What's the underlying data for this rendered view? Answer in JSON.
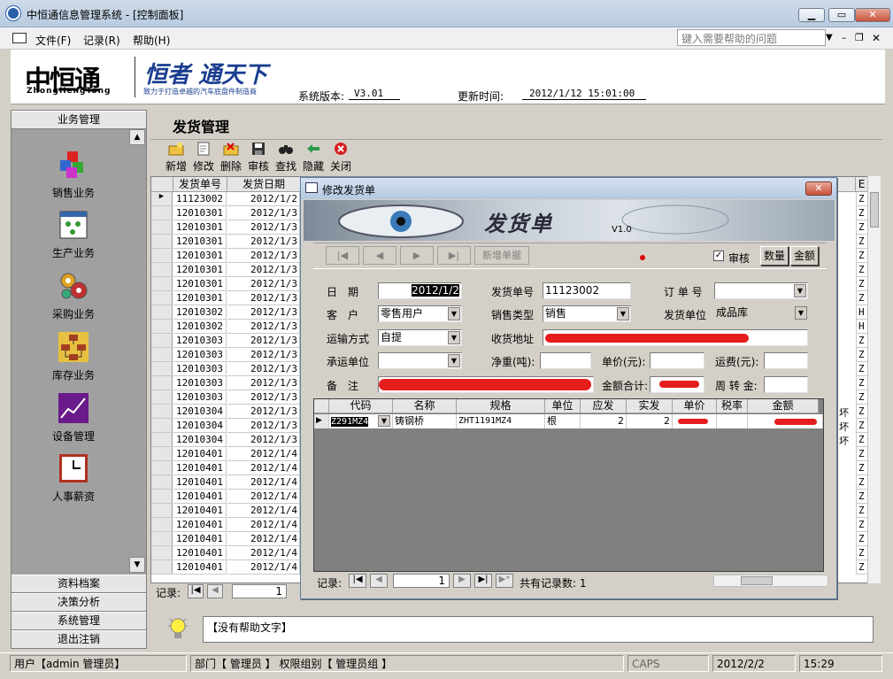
{
  "window": {
    "title": "中恒通信息管理系统 - [控制面板]"
  },
  "menu": {
    "items": [
      "文件(F)",
      "记录(R)",
      "帮助(H)"
    ],
    "help_placeholder": "键入需要帮助的问题"
  },
  "banner": {
    "logo_text": "中恒通",
    "logo_sub": "ZhongHengTong",
    "slogan": "恒者 通天下",
    "slogan_sub": "致力于打造卓越的汽车底盘件制造商",
    "version_label": "系统版本:",
    "version": "V3.01",
    "update_label": "更新时间:",
    "update_time": "2012/1/12 15:01:00"
  },
  "sidebar": {
    "top_header": "业务管理",
    "items": [
      "销售业务",
      "生产业务",
      "采购业务",
      "库存业务",
      "设备管理",
      "人事薪资"
    ],
    "bottom_headers": [
      "资料档案",
      "决策分析",
      "系统管理",
      "退出注销"
    ]
  },
  "main": {
    "title": "发货管理",
    "toolbar": [
      "新增",
      "修改",
      "删除",
      "审核",
      "查找",
      "隐藏",
      "关闭"
    ],
    "grid": {
      "headers": [
        "发货单号",
        "发货日期"
      ],
      "rows": [
        {
          "no": "11123002",
          "date": "2012/1/2",
          "tail": "Z"
        },
        {
          "no": "12010301",
          "date": "2012/1/3",
          "tail": "Z"
        },
        {
          "no": "12010301",
          "date": "2012/1/3",
          "tail": "Z"
        },
        {
          "no": "12010301",
          "date": "2012/1/3",
          "tail": "Z"
        },
        {
          "no": "12010301",
          "date": "2012/1/3",
          "tail": "Z"
        },
        {
          "no": "12010301",
          "date": "2012/1/3",
          "tail": "Z"
        },
        {
          "no": "12010301",
          "date": "2012/1/3",
          "tail": "Z"
        },
        {
          "no": "12010301",
          "date": "2012/1/3",
          "tail": "Z"
        },
        {
          "no": "12010302",
          "date": "2012/1/3",
          "tail": "H"
        },
        {
          "no": "12010302",
          "date": "2012/1/3",
          "tail": "H"
        },
        {
          "no": "12010303",
          "date": "2012/1/3",
          "tail": "Z"
        },
        {
          "no": "12010303",
          "date": "2012/1/3",
          "tail": "Z"
        },
        {
          "no": "12010303",
          "date": "2012/1/3",
          "tail": "Z"
        },
        {
          "no": "12010303",
          "date": "2012/1/3",
          "tail": "Z"
        },
        {
          "no": "12010303",
          "date": "2012/1/3",
          "tail": "Z"
        },
        {
          "no": "12010304",
          "date": "2012/1/3",
          "tail": "Z"
        },
        {
          "no": "12010304",
          "date": "2012/1/3",
          "tail": "Z"
        },
        {
          "no": "12010304",
          "date": "2012/1/3",
          "tail": "Z"
        },
        {
          "no": "12010401",
          "date": "2012/1/4",
          "tail": "Z"
        },
        {
          "no": "12010401",
          "date": "2012/1/4",
          "tail": "Z"
        },
        {
          "no": "12010401",
          "date": "2012/1/4",
          "tail": "Z"
        },
        {
          "no": "12010401",
          "date": "2012/1/4",
          "tail": "Z"
        },
        {
          "no": "12010401",
          "date": "2012/1/4",
          "tail": "Z"
        },
        {
          "no": "12010401",
          "date": "2012/1/4",
          "tail": "Z"
        },
        {
          "no": "12010401",
          "date": "2012/1/4",
          "tail": "Z"
        },
        {
          "no": "12010401",
          "date": "2012/1/4",
          "tail": "Z"
        },
        {
          "no": "12010401",
          "date": "2012/1/4",
          "tail": "Z"
        }
      ],
      "tail_header": "E",
      "side_text": [
        "坏",
        "坏",
        "坏"
      ],
      "record_label": "记录:",
      "record_value": "1"
    },
    "help_text": "【没有帮助文字】"
  },
  "dialog": {
    "title": "修改发货单",
    "banner_title": "发货单",
    "banner_version": "V1.0",
    "nav_new": "新增单据",
    "check_label": "审核",
    "check_mark": "✓",
    "btn_qty": "数量",
    "btn_amount": "金额",
    "fields": {
      "date_label": "日　期",
      "date": "2012/1/2",
      "order_no_label": "发货单号",
      "order_no": "11123002",
      "po_label": "订 单 号",
      "po": "",
      "customer_label": "客　户",
      "customer": "零售用户",
      "sale_type_label": "销售类型",
      "sale_type": "销售",
      "ship_unit_label": "发货单位",
      "ship_unit": "成品库",
      "transport_label": "运输方式",
      "transport": "自提",
      "address_label": "收货地址",
      "carrier_label": "承运单位",
      "carrier": "",
      "weight_label": "净重(吨):",
      "unit_price_label": "单价(元):",
      "freight_label": "运费(元):",
      "remark_label": "备　注",
      "total_label": "金额合计:",
      "turnover_label": "周 转 金:"
    },
    "items": {
      "headers": [
        "代码",
        "名称",
        "规格",
        "单位",
        "应发",
        "实发",
        "单价",
        "税率",
        "金额"
      ],
      "rows": [
        {
          "code": "Z291MZ4",
          "name": "铸钢桥",
          "spec": "ZHT1191MZ4",
          "unit": "根",
          "due": "2",
          "actual": "2"
        }
      ]
    },
    "record_label": "记录:",
    "record_value": "1",
    "total_records": "共有记录数: 1"
  },
  "status": {
    "user": "用户【admin 管理员】",
    "dept": "部门【 管理员 】 权限组别【 管理员组 】",
    "caps": "CAPS",
    "date": "2012/2/2",
    "time": "15:29"
  }
}
